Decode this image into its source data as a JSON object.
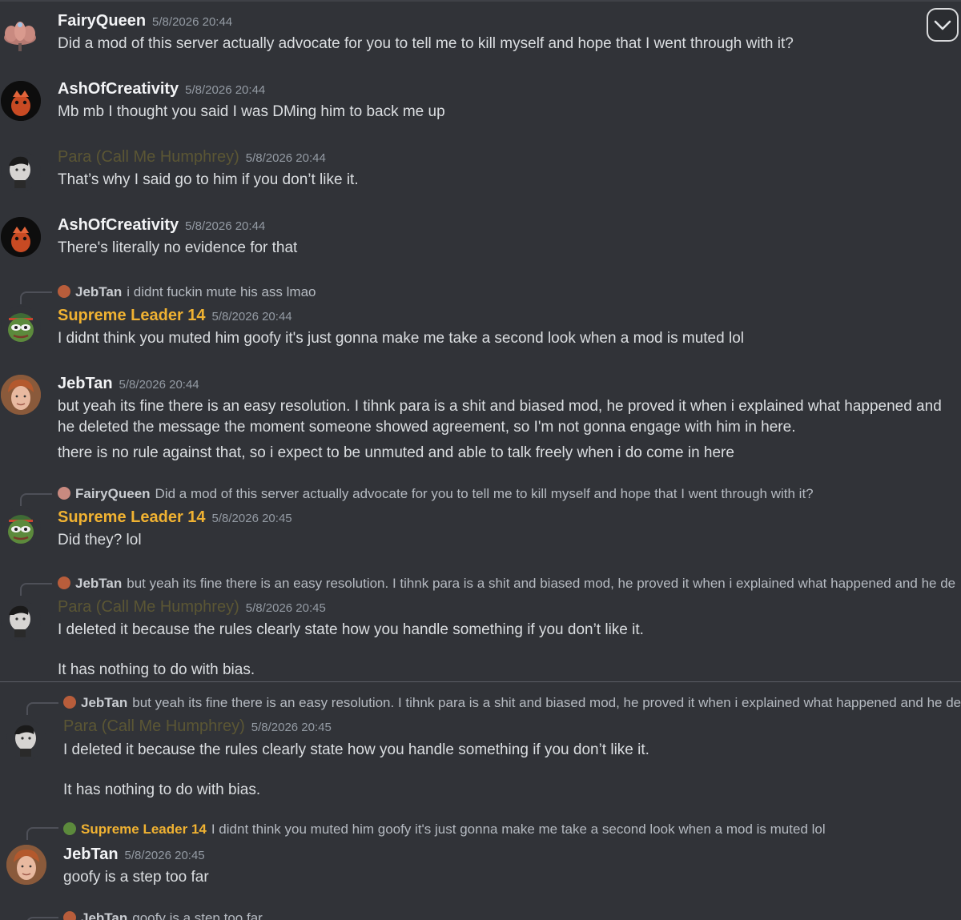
{
  "ui": {
    "scroll_button_icon": "chevron-down-icon",
    "colors": {
      "background": "#313338",
      "username_default": "#f2f3f5",
      "username_supreme": "#f0b232",
      "username_para": "#5b5634",
      "timestamp": "#949ba4",
      "message_text": "#dbdee1"
    }
  },
  "messages": [
    {
      "avatar": "lotus-avatar",
      "username": "FairyQueen",
      "timestamp": "5/8/2026 20:44",
      "lines": [
        "Did a mod of this server actually advocate for you to tell me to kill myself and hope that I went through with it?"
      ]
    },
    {
      "avatar": "dark-red-avatar",
      "username": "AshOfCreativity",
      "timestamp": "5/8/2026 20:44",
      "lines": [
        "Mb mb I thought you said I was DMing him to back me up"
      ]
    },
    {
      "avatar": "humphrey-avatar",
      "username": "Para (Call Me Humphrey)",
      "timestamp": "5/8/2026 20:44",
      "lines": [
        "That’s why I said go to him if you don’t like it."
      ]
    },
    {
      "avatar": "dark-red-avatar",
      "username": "AshOfCreativity",
      "timestamp": "5/8/2026 20:44",
      "lines": [
        "There's literally no evidence for that"
      ]
    },
    {
      "reply_to": {
        "username": "JebTan",
        "text": "i didnt fuckin mute his ass lmao"
      },
      "avatar": "pepe-avatar",
      "username": "Supreme Leader 14",
      "timestamp": "5/8/2026 20:44",
      "lines": [
        "I didnt think you muted him goofy it's just gonna make me take a second look when a mod is muted lol"
      ]
    },
    {
      "avatar": "jebtan-avatar",
      "username": "JebTan",
      "timestamp": "5/8/2026 20:44",
      "lines": [
        "but yeah its fine there is an easy resolution. I tihnk para is a shit and biased mod, he proved it when i explained what happened and he deleted the message the moment someone showed agreement, so I'm not gonna engage with him in here.",
        "there is no rule against that, so i expect to be unmuted and able to talk freely when i do come in here"
      ]
    },
    {
      "reply_to": {
        "username": "FairyQueen",
        "text": "Did a mod of this server actually advocate for you to tell me to kill myself and hope that I went through with it?"
      },
      "avatar": "pepe-avatar",
      "username": "Supreme Leader 14",
      "timestamp": "5/8/2026 20:45",
      "lines": [
        "Did they? lol"
      ]
    },
    {
      "reply_to": {
        "username": "JebTan",
        "text": "but yeah its fine there is an easy resolution. I tihnk para is a shit and biased mod, he proved it when i explained what happened and he de"
      },
      "avatar": "humphrey-avatar",
      "username": "Para (Call Me Humphrey)",
      "timestamp": "5/8/2026 20:45",
      "lines": [
        "I deleted it because the rules clearly state how you handle something if you don’t like it.",
        "It has nothing to do with bias."
      ]
    },
    {
      "reply_to": {
        "username": "JebTan",
        "text": "but yeah its fine there is an easy resolution. I tihnk para is a shit and biased mod, he proved it when i explained what happened and he de"
      },
      "avatar": "humphrey-avatar",
      "username": "Para (Call Me Humphrey)",
      "timestamp": "5/8/2026 20:45",
      "lines": [
        "I deleted it because the rules clearly state how you handle something if you don’t like it.",
        "It has nothing to do with bias."
      ]
    },
    {
      "reply_to": {
        "username": "Supreme Leader 14",
        "text": "I didnt think you muted him goofy it's just gonna make me take a second look when a mod is muted lol"
      },
      "avatar": "jebtan-avatar",
      "username": "JebTan",
      "timestamp": "5/8/2026 20:45",
      "lines": [
        "goofy is a step too far"
      ]
    },
    {
      "reply_to": {
        "username": "JebTan",
        "text": "goofy is a step too far"
      }
    }
  ]
}
